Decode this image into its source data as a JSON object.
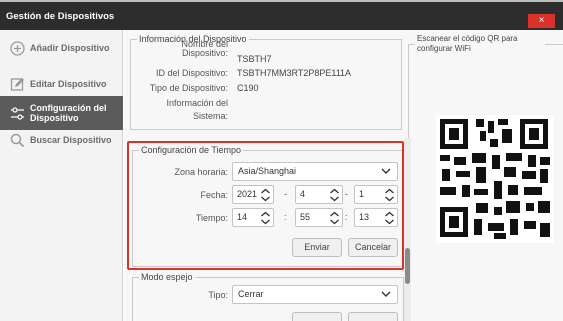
{
  "window": {
    "title": "Gestión de Dispositivos",
    "close_label": "×"
  },
  "sidebar": {
    "items": [
      {
        "label": "Añadir Dispositivo",
        "icon": "plus-circle-icon",
        "active": false
      },
      {
        "label": "Editar Dispositivo",
        "icon": "edit-icon",
        "active": false
      },
      {
        "label_line1": "Configuración del",
        "label_line2": "Dispositivo",
        "icon": "sliders-icon",
        "active": true
      },
      {
        "label": "Buscar Dispositivo",
        "icon": "search-icon",
        "active": false
      }
    ]
  },
  "device_info": {
    "legend": "Información del Dispositivo",
    "name_label": "Nombre del Dispositivo:",
    "name_value": "TSBTH7",
    "id_label": "ID del Dispositivo:",
    "id_value": "TSBTH7MM3RT2P8PE111A",
    "type_label": "Tipo de Dispositivo:",
    "type_value": "C190",
    "system_info_label_line1": "Información del",
    "system_info_label_line2": "Sistema:"
  },
  "qr": {
    "legend": "Escanear el código QR para configurar WiFi"
  },
  "time_config": {
    "legend": "Configuración de Tiempo",
    "timezone_label": "Zona horaria:",
    "timezone_value": "Asia/Shanghai",
    "date_label": "Fecha:",
    "year": "2021",
    "month": "4",
    "day": "1",
    "date_sep": "-",
    "time_label": "Tiempo:",
    "hour": "14",
    "minute": "55",
    "second": "13",
    "time_sep": ":",
    "send_label": "Enviar",
    "cancel_label": "Cancelar"
  },
  "mirror": {
    "legend": "Modo espejo",
    "type_label": "Tipo:",
    "type_value": "Cerrar"
  },
  "colors": {
    "accent_red": "#d9322a",
    "active_nav": "#5b5b5b",
    "titlebar": "#2d2d2d"
  }
}
